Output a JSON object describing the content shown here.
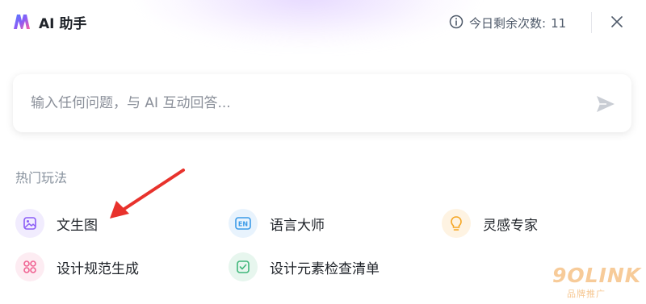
{
  "header": {
    "title": "AI 助手",
    "remaining_label": "今日剩余次数:",
    "remaining_count": "11"
  },
  "input": {
    "placeholder": "输入任何问题，与 AI 互动回答..."
  },
  "section": {
    "title": "热门玩法",
    "items": [
      {
        "label": "文生图",
        "icon": "image-icon",
        "color": "#8b5cf6"
      },
      {
        "label": "语言大师",
        "icon": "en-icon",
        "color": "#3b9be8"
      },
      {
        "label": "灵感专家",
        "icon": "lightbulb-icon",
        "color": "#f5a623"
      },
      {
        "label": "设计规范生成",
        "icon": "grid-icon",
        "color": "#f06292"
      },
      {
        "label": "设计元素检查清单",
        "icon": "checklist-icon",
        "color": "#3fb67a"
      }
    ]
  },
  "watermark": {
    "main": "9OLINK",
    "sub": "品牌推广"
  }
}
